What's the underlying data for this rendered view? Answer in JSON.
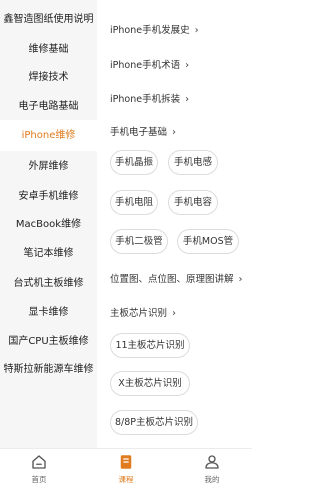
{
  "sidebar": {
    "items": [
      {
        "label": "鑫智造图纸使用说明"
      },
      {
        "label": "维修基础"
      },
      {
        "label": "焊接技术"
      },
      {
        "label": "电子电路基础"
      },
      {
        "label": "iPhone维修",
        "active": true
      },
      {
        "label": "外屏维修"
      },
      {
        "label": "安卓手机维修"
      },
      {
        "label": "MacBook维修"
      },
      {
        "label": "笔记本维修"
      },
      {
        "label": "台式机主板维修"
      },
      {
        "label": "显卡维修"
      },
      {
        "label": "国产CPU主板维修"
      },
      {
        "label": "特斯拉新能源车维修"
      }
    ]
  },
  "main": {
    "sections": {
      "history": "iPhone手机发展史",
      "terms": "iPhone手机术语",
      "disassembly": "iPhone手机拆装",
      "components": "手机电子基础",
      "diagrams": "位置图、点位图、原理图讲解",
      "chips": "主板芯片识别"
    },
    "component_chips": [
      "手机晶振",
      "手机电感",
      "手机电阻",
      "手机电容",
      "手机二极管",
      "手机MOS管"
    ],
    "chip_chips": [
      "11主板芯片识别",
      "X主板芯片识别",
      "8/8P主板芯片识别"
    ]
  },
  "tabbar": {
    "home": "首页",
    "courses": "课程",
    "mine": "我的"
  },
  "colors": {
    "accent": "#e07b1f",
    "sidebar_bg": "#f6f6f6"
  },
  "icons": [
    "home-icon",
    "courses-icon",
    "user-icon",
    "chevron-right-icon"
  ]
}
